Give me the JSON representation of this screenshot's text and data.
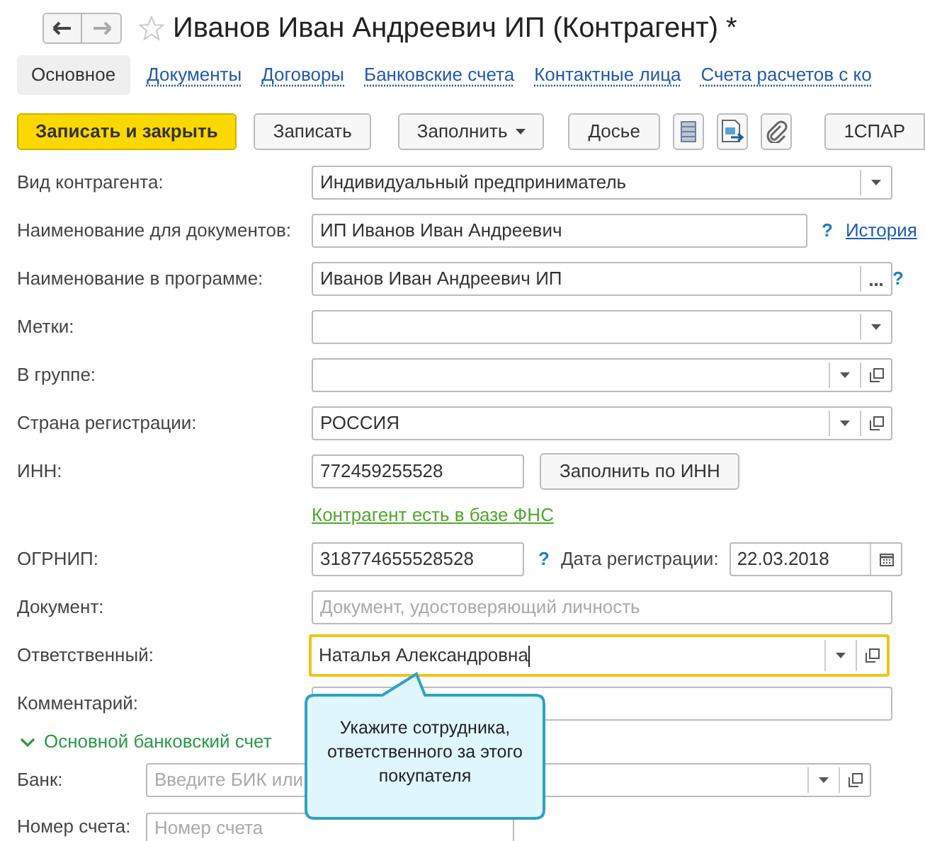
{
  "window": {
    "title": "Иванов Иван Андреевич ИП (Контрагент) *",
    "favorite": false
  },
  "tabs": [
    {
      "label": "Основное",
      "selected": true
    },
    {
      "label": "Документы",
      "selected": false
    },
    {
      "label": "Договоры",
      "selected": false
    },
    {
      "label": "Банковские счета",
      "selected": false
    },
    {
      "label": "Контактные лица",
      "selected": false
    },
    {
      "label": "Счета расчетов с ко",
      "selected": false
    }
  ],
  "toolbar": [
    {
      "kind": "primary",
      "label": "Записать и закрыть"
    },
    {
      "kind": "button",
      "label": "Записать"
    },
    {
      "kind": "menu",
      "label": "Заполнить"
    },
    {
      "kind": "button",
      "label": "Досье"
    },
    {
      "kind": "icon"
    },
    {
      "kind": "icon"
    },
    {
      "kind": "icon"
    },
    {
      "kind": "button",
      "label": "1СПАР"
    }
  ],
  "fields": [
    {
      "label": "Вид контрагента:",
      "kind": "select",
      "value": "Индивидуальный предприниматель"
    },
    {
      "label": "Наименование для документов:",
      "kind": "text",
      "value": "ИП Иванов Иван Андреевич",
      "help": "?",
      "link": "История"
    },
    {
      "label": "Наименование в программе:",
      "kind": "choice",
      "value": "Иванов Иван Андреевич ИП",
      "help": "?"
    },
    {
      "label": "Метки:",
      "kind": "select"
    },
    {
      "label": "В группе:",
      "kind": "select-open"
    },
    {
      "label": "Страна регистрации:",
      "kind": "select-open",
      "value": "РОССИЯ"
    },
    {
      "label": "ИНН:",
      "kind": "short",
      "value": "772459255528",
      "button": "Заполнить по ИНН"
    },
    {
      "kind": "note",
      "link": "Контрагент есть в базе ФНС"
    },
    {
      "label": "ОГРНИП:",
      "kind": "short",
      "value": "318774655528528",
      "help": "?",
      "date_label": "Дата регистрации:",
      "date": "22.03.2018"
    },
    {
      "label": "Документ:",
      "kind": "text-wide",
      "placeholder": "Документ, удостоверяющий личность"
    },
    {
      "label": "Ответственный:",
      "kind": "select-open",
      "value": "Наталья Александровна",
      "focused": true
    },
    {
      "label": "Комментарий:",
      "kind": "text-wide"
    }
  ],
  "bank_section": {
    "title": "Основной банковский счет",
    "expanded": true,
    "fields": [
      {
        "label": "Банк:",
        "kind": "select-open",
        "placeholder": "Введите БИК или"
      },
      {
        "label": "Номер счета:",
        "kind": "text",
        "placeholder": "Номер счета"
      }
    ]
  },
  "callout": {
    "text": "Укажите сотрудника, ответственного за этого покупателя"
  }
}
